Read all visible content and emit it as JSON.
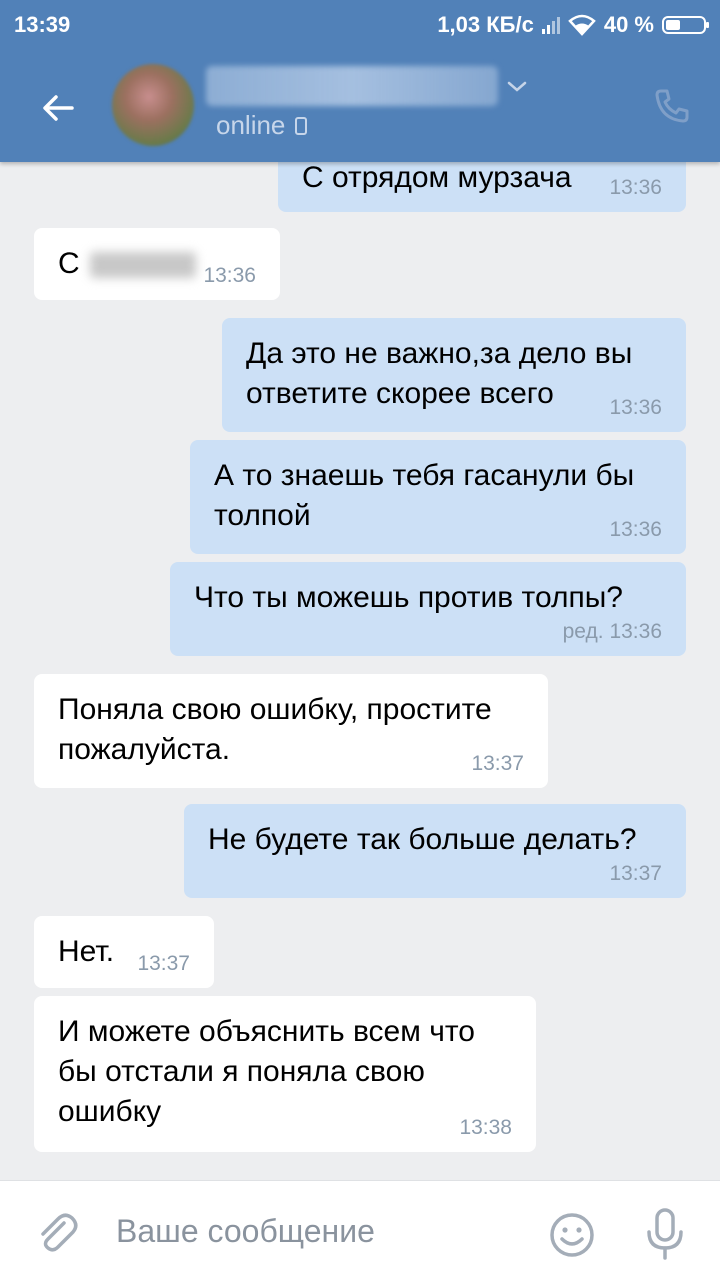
{
  "status_bar": {
    "time": "13:39",
    "network_speed": "1,03 КБ/с",
    "battery": "40 %"
  },
  "header": {
    "status": "online",
    "back_icon": "arrow-left-icon",
    "call_icon": "phone-call-icon"
  },
  "messages": [
    {
      "dir": "out",
      "text": "С отрядом мурзача",
      "time": "13:36"
    },
    {
      "dir": "in",
      "text": "С",
      "time": "13:36"
    },
    {
      "dir": "out",
      "text": "Да это не важно,за дело вы ответите скорее всего",
      "time": "13:36"
    },
    {
      "dir": "out",
      "text": "А то знаешь тебя гасанули бы толпой",
      "time": "13:36"
    },
    {
      "dir": "out",
      "text": "Что ты можешь против толпы?",
      "time": "ред. 13:36"
    },
    {
      "dir": "in",
      "text": "Поняла свою ошибку, простите пожалуйста.",
      "time": "13:37"
    },
    {
      "dir": "out",
      "text": "Не будете так больше делать?",
      "time": "13:37"
    },
    {
      "dir": "in",
      "text": "Нет.",
      "time": "13:37"
    },
    {
      "dir": "in",
      "text": "И можете объяснить всем что бы отстали я поняла свою ошибку",
      "time": "13:38"
    }
  ],
  "composer": {
    "placeholder": "Ваше сообщение",
    "attach_icon": "paperclip-icon",
    "emoji_icon": "smile-icon",
    "voice_icon": "microphone-icon"
  },
  "colors": {
    "header": "#5181b8",
    "outgoing_bubble": "#cce0f6",
    "incoming_bubble": "#ffffff",
    "background": "#edeef0"
  }
}
